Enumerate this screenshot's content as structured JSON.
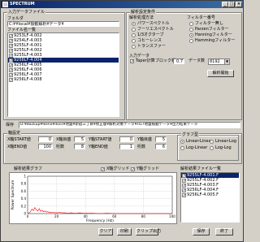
{
  "window": {
    "title": "SPECTRUM"
  },
  "input_file": {
    "group_label": "入力データファイル",
    "folder_label": "フォルダ",
    "folder_value": "C:¥¥local¥振動解析¥データ¥",
    "file_list_label": "ファイル名一覧",
    "files": [
      {
        "name": "9253LF-4.002",
        "checked": true
      },
      {
        "name": "9254LF-4.003",
        "checked": true
      },
      {
        "name": "9255LF-4.001",
        "checked": true
      },
      {
        "name": "9255LF-4.002",
        "checked": true
      },
      {
        "name": "9255LF-4.003",
        "checked": true
      },
      {
        "name": "9256LF-4.004",
        "checked": true
      },
      {
        "name": "9256LF-4.005",
        "checked": true
      },
      {
        "name": "9256LF-4.006",
        "checked": true
      },
      {
        "name": "9256LF-4.007",
        "checked": true
      },
      {
        "name": "9256LF-4.008",
        "checked": true
      }
    ],
    "selected_index": 5
  },
  "analysis": {
    "group_label": "解析設定条件",
    "method_label": "解析処理方法",
    "methods": [
      "パワースペクトル",
      "フーリエスペクトル",
      "1/3オクターブ",
      "コヒーレンス",
      "トランスファー"
    ],
    "method_selected": 0,
    "filter_label": "フィルター番号",
    "filters": [
      "フィルター無し",
      "Parzenフィルター",
      "Hanningフィルター",
      "Hammingフィルター"
    ],
    "filter_selected": 2,
    "input_label": "入力データ",
    "taper_label": "Taper計算",
    "taper_checked": true,
    "block_label": "ブロック幅",
    "block_value": "0.7",
    "data_count_label": "データ数",
    "data_count_value": "8192",
    "run_button": "解析開始"
  },
  "save": {
    "label": "保存",
    "path": "D:¥Backup¥Ikeno¥docs¥地盤¥新宿三丁目¥修正版¥解析対象データ¥H17地盤振動データ¥出力結果データ"
  },
  "axis": {
    "group_label": "軸設定",
    "x_start_label": "X軸START値",
    "x_start_value": "0",
    "x_div_label": "X軸目盛",
    "x_div_value": "5",
    "y_start_label": "Y軸START値",
    "y_start_value": "0",
    "y_div_label": "Y軸目盛",
    "y_div_value": "5",
    "x_end_label": "X軸END値",
    "x_end_value": "100",
    "x_scale_label": "桁数",
    "x_scale_value": "8",
    "y_end_label": "Y軸END値",
    "y_end_value": "1",
    "y_scale_label": "桁数",
    "y_scale_value": "6",
    "graph_type_label": "グラフ型",
    "graph_types": [
      "Linear-Linear",
      "Log-Linear",
      "Linear-Log",
      "Log-Log"
    ],
    "graph_type_selected": 0
  },
  "result": {
    "graph_label": "解析結果グラフ",
    "x_grid_label": "X軸グリッド",
    "y_grid_label": "Y軸グリッド",
    "file_list_label": "解析結果ファイル一覧",
    "files": [
      {
        "name": "9255LF-4.001.F",
        "checked": true
      },
      {
        "name": "9255LF-4.002.F",
        "checked": true
      },
      {
        "name": "9255LF-4.003.F",
        "checked": true
      },
      {
        "name": "9256LF-4.004.F",
        "checked": true
      },
      {
        "name": "9256LF-4.005.F",
        "checked": true
      }
    ],
    "selected_index": 0
  },
  "chart_data": {
    "type": "line",
    "xlabel": "Frequency (Hz)",
    "ylabel": "Power Spectrum",
    "xlim": [
      0,
      100
    ],
    "ylim": [
      0,
      1
    ],
    "x_ticks": [
      "0",
      "20",
      "40",
      "60",
      "80",
      "100"
    ],
    "y_ticks": [
      "0",
      "0.2",
      "0.4",
      "0.6",
      "0.8",
      "1"
    ],
    "series": [
      {
        "color": "#ff0000",
        "x": [
          0,
          1,
          2,
          3,
          4,
          5,
          6,
          7,
          8,
          9,
          10,
          11,
          12,
          13,
          14,
          15,
          16,
          18,
          20,
          22,
          24,
          26,
          28,
          30,
          32,
          34,
          36,
          38,
          40,
          45,
          50,
          55,
          60,
          65,
          70,
          80,
          90,
          100
        ],
        "y": [
          0.0,
          0.02,
          0.05,
          0.12,
          0.08,
          0.16,
          0.1,
          0.07,
          0.13,
          0.06,
          0.09,
          0.05,
          0.07,
          0.04,
          0.05,
          0.03,
          0.04,
          0.03,
          0.02,
          0.03,
          0.02,
          0.02,
          0.01,
          0.02,
          0.01,
          0.01,
          0.02,
          0.01,
          0.01,
          0.01,
          0.0,
          0.01,
          0.0,
          0.0,
          0.0,
          0.0,
          0.0,
          0.0
        ]
      }
    ]
  },
  "buttons": {
    "clear": "クリア",
    "print": "印刷",
    "clipboard": "クリップ出力",
    "save": "保存",
    "exit": "終了"
  }
}
